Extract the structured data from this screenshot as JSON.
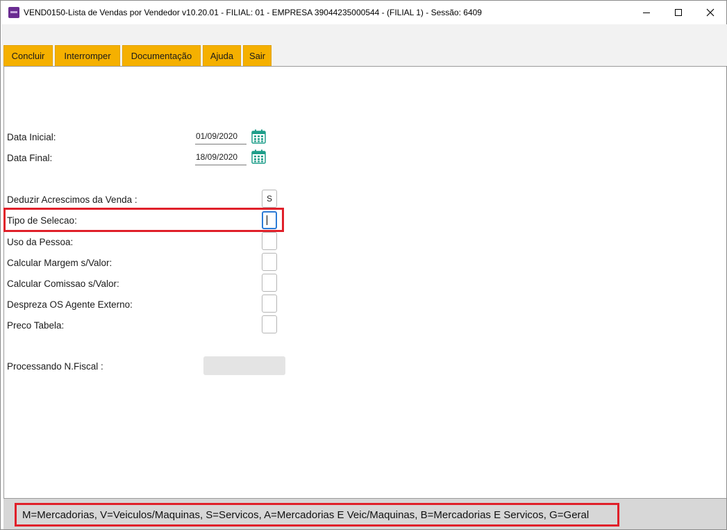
{
  "window": {
    "title": "VEND0150-Lista de Vendas por Vendedor v10.20.01   - FILIAL: 01 - EMPRESA 39044235000544 - (FILIAL 1) - Sessão: 6409"
  },
  "toolbar": {
    "concluir": "Concluir",
    "interromper": "Interromper",
    "documentacao": "Documentação",
    "ajuda": "Ajuda",
    "sair": "Sair"
  },
  "form": {
    "data_inicial_label": "Data Inicial:",
    "data_inicial_value": "01/09/2020",
    "data_final_label": "Data Final:",
    "data_final_value": "18/09/2020",
    "deduzir_label": "Deduzir Acrescimos da Venda :",
    "deduzir_value": "S",
    "tipo_selecao_label": "Tipo de Selecao:",
    "tipo_selecao_value": "",
    "uso_pessoa_label": "Uso da Pessoa:",
    "uso_pessoa_value": "",
    "calc_margem_label": "Calcular Margem s/Valor:",
    "calc_margem_value": "",
    "calc_comissao_label": "Calcular Comissao s/Valor:",
    "calc_comissao_value": "",
    "despreza_os_label": "Despreza OS Agente Externo:",
    "despreza_os_value": "",
    "preco_tabela_label": "Preco Tabela:",
    "preco_tabela_value": "",
    "processando_label": "Processando N.Fiscal :"
  },
  "status": {
    "hint": "M=Mercadorias, V=Veiculos/Maquinas, S=Servicos, A=Mercadorias E Veic/Maquinas, B=Mercadorias E Servicos, G=Geral"
  },
  "colors": {
    "tab_background": "#f5b000",
    "highlight_border": "#e0202a",
    "focus_border": "#2b7bd6",
    "calendar_icon": "#1f9e8a"
  },
  "icons": {
    "app": "app-icon",
    "calendar": "calendar-icon",
    "minimize": "minimize-icon",
    "maximize": "maximize-icon",
    "close": "close-icon"
  }
}
